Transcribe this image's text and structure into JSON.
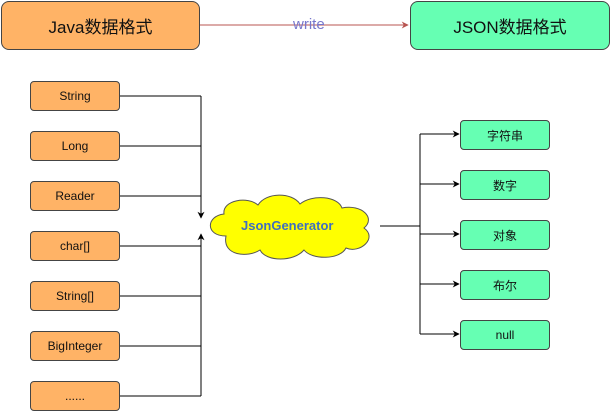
{
  "header": {
    "source_label": "Java数据格式",
    "target_label": "JSON数据格式",
    "write_label": "write"
  },
  "generator": {
    "label": "JsonGenerator"
  },
  "java_types": [
    "String",
    "Long",
    "Reader",
    "char[]",
    "String[]",
    "BigInteger",
    "......"
  ],
  "json_types": [
    "字符串",
    "数字",
    "对象",
    "布尔",
    "null"
  ],
  "colors": {
    "java_box": "#ffb366",
    "json_box": "#66ffb3",
    "cloud_fill": "#ffff00",
    "line": "#000000",
    "write_arrow": "#b85450"
  }
}
